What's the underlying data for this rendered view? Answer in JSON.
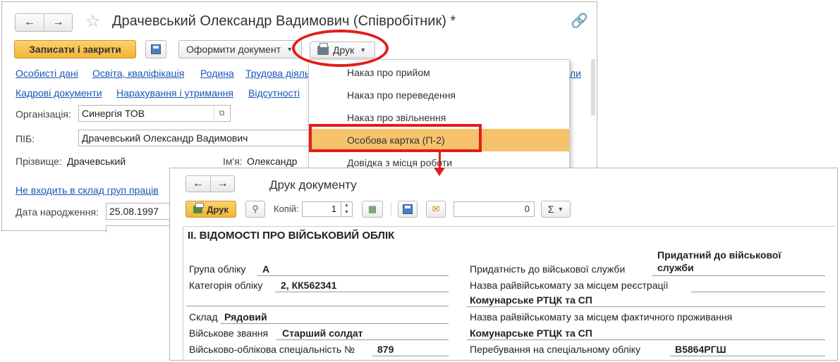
{
  "employee_form": {
    "title": "Драчевський Олександр Вадимович (Співробітник) *",
    "toolbar": {
      "save_close_label": "Записати і закрити",
      "create_doc_label": "Оформити документ",
      "print_label": "Друк"
    },
    "tabs_row1": [
      "Особисті дані",
      "Освіта, кваліфікація",
      "Родина",
      "Трудова діяль"
    ],
    "tabs_row1_tail": "ли",
    "tabs_row2": [
      "Кадрові документи",
      "Нарахування і утримання",
      "Відсутності"
    ],
    "org_label": "Організація:",
    "org_value": "Синергія ТОВ",
    "name_label": "ПІБ:",
    "name_value": "Драчевський Олександр Вадимович",
    "surname_label": "Прізвище:",
    "surname_value": "Драчевський",
    "firstname_label": "Ім'я:",
    "firstname_value": "Олександр",
    "groups_link": "Не входить в склад груп праців",
    "birth_label": "Дата народження:",
    "birth_value": "25.08.1997"
  },
  "print_menu": {
    "items": [
      "Наказ про прийом",
      "Наказ про переведення",
      "Наказ про звільнення",
      "Особова картка (П-2)",
      "Довідка з місця роботи"
    ],
    "highlighted_index": 3
  },
  "print_window": {
    "title": "Друк документу",
    "print_button": "Друк",
    "copies_label": "Копій:",
    "copies_value": "1",
    "sum_value": "0",
    "sum_symbol": "Σ",
    "report": {
      "heading": "ІІ. ВІДОМОСТІ ПРО ВІЙСЬКОВИЙ ОБЛІК",
      "left": [
        {
          "label": "Група обліку",
          "value": "А"
        },
        {
          "label": "Категорія обліку",
          "value": "2, КК562341"
        },
        {
          "label": "Склад",
          "value": "Рядовий"
        },
        {
          "label": "Військове звання",
          "value": "Старший солдат"
        },
        {
          "label": "Військово-облікова спеціальність №",
          "value": "879"
        }
      ],
      "right": [
        {
          "label": "Придатність до військової служби",
          "value_line1": "Придатний до військової",
          "value_line2": "служби"
        },
        {
          "label": "Назва райвійськомату за місцем реєстрації",
          "value": "Комунарське РТЦК та СП"
        },
        {
          "label": "Назва райвійськомату за місцем фактичного проживання",
          "value": "Комунарське РТЦК та СП"
        },
        {
          "label": "Перебування на спеціальному обліку",
          "value": "В5864РГШ"
        }
      ]
    }
  },
  "colors": {
    "accent_yellow": "#f2b437",
    "highlight_orange": "#f6c26b",
    "annotation_red": "#e21d1d",
    "link_blue": "#1a56b8"
  }
}
